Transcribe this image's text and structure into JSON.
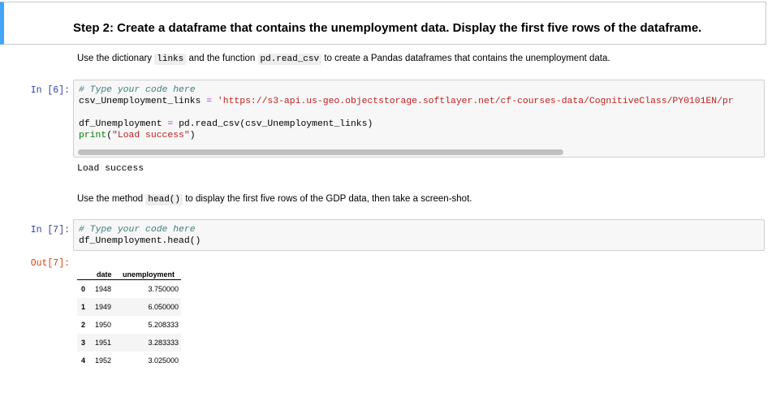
{
  "step": {
    "title": "Step 2: Create a dataframe that contains the unemployment data. Display the first five rows of the dataframe."
  },
  "instruction1": {
    "pre": "Use the dictionary ",
    "code1": "links",
    "mid": " and the function ",
    "code2": "pd.read_csv",
    "post": " to create a Pandas dataframes that contains the unemployment data."
  },
  "cell6": {
    "prompt": "In [6]:",
    "line1": "# Type your code here",
    "line2_var": "csv_Unemployment_links",
    "line2_eq": " = ",
    "line2_str": "'https://s3-api.us-geo.objectstorage.softlayer.net/cf-courses-data/CognitiveClass/PY0101EN/pr",
    "line3_var": "df_Unemployment",
    "line3_eq": " = ",
    "line3_rest": "pd.read_csv(csv_Unemployment_links)",
    "line4_kw": "print",
    "line4_open": "(",
    "line4_str": "\"Load success\"",
    "line4_close": ")",
    "output": "Load success"
  },
  "instruction2": {
    "pre": "Use the method ",
    "code1": "head()",
    "post": " to display the first five rows of the GDP data, then take a screen-shot."
  },
  "cell7": {
    "prompt": "In [7]:",
    "line1": "# Type your code here",
    "line2": "df_Unemployment.head()",
    "out_prompt": "Out[7]:"
  },
  "dataframe": {
    "columns": [
      "date",
      "unemployment"
    ],
    "rows": [
      {
        "index": "0",
        "date": "1948",
        "unemployment": "3.750000"
      },
      {
        "index": "1",
        "date": "1949",
        "unemployment": "6.050000"
      },
      {
        "index": "2",
        "date": "1950",
        "unemployment": "5.208333"
      },
      {
        "index": "3",
        "date": "1951",
        "unemployment": "3.283333"
      },
      {
        "index": "4",
        "date": "1952",
        "unemployment": "3.025000"
      }
    ]
  },
  "colors": {
    "selected_border": "#42a5f5",
    "in_prompt": "#303f9f",
    "out_prompt": "#d84315",
    "comment": "#408080",
    "string": "#ba2121",
    "operator": "#aa22ff",
    "keyword": "#008000"
  }
}
